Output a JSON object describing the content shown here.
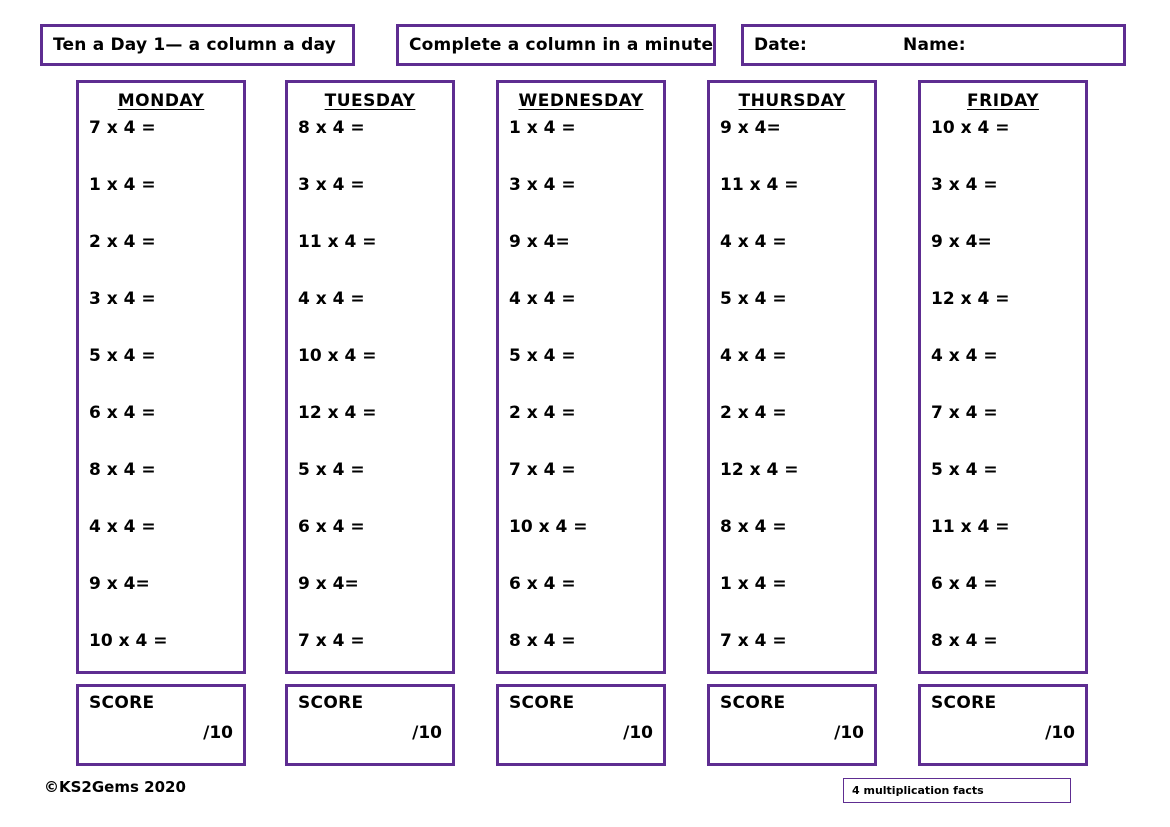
{
  "page": {
    "title_box": "Ten a Day 1— a column a day",
    "instruction_box": "Complete a column in a minute",
    "date_label": "Date:",
    "name_label": "Name:",
    "copyright": "©KS2Gems 2020",
    "footer_tag": "4 multiplication facts",
    "accent_color": "#5e2d91",
    "background_color": "#ffffff"
  },
  "score": {
    "label": "SCORE",
    "out_of": "/10"
  },
  "columns": [
    {
      "day": "MONDAY",
      "questions": [
        "7 x 4 =",
        "1 x 4 =",
        "2 x 4 =",
        "3 x 4 =",
        "5 x 4 =",
        "6 x 4 =",
        "8 x 4 =",
        "4 x 4 =",
        "9 x 4=",
        "10 x 4 ="
      ]
    },
    {
      "day": "TUESDAY",
      "questions": [
        "8 x 4 =",
        "3 x 4 =",
        "11 x 4 =",
        "4 x 4 =",
        "10 x 4 =",
        "12 x 4 =",
        "5 x 4 =",
        "6 x 4 =",
        "9 x 4=",
        "7 x 4 ="
      ]
    },
    {
      "day": "WEDNESDAY",
      "questions": [
        "1 x 4 =",
        "3 x 4 =",
        "9 x 4=",
        "4 x 4 =",
        "5 x 4 =",
        "2 x 4 =",
        "7 x 4 =",
        "10 x 4 =",
        "6 x 4 =",
        "8 x 4 ="
      ]
    },
    {
      "day": "THURSDAY",
      "questions": [
        "9 x 4=",
        "11 x 4 =",
        "4 x 4 =",
        "5 x 4 =",
        "4 x 4 =",
        "2 x 4 =",
        "12 x 4 =",
        "8 x 4 =",
        "1 x 4 =",
        "7 x 4 ="
      ]
    },
    {
      "day": "FRIDAY",
      "questions": [
        "10 x 4 =",
        "3 x 4 =",
        "9 x 4=",
        "12 x 4 =",
        "4 x 4 =",
        "7 x 4 =",
        "5 x 4 =",
        "11 x 4 =",
        "6 x 4 =",
        "8 x 4 ="
      ]
    }
  ]
}
